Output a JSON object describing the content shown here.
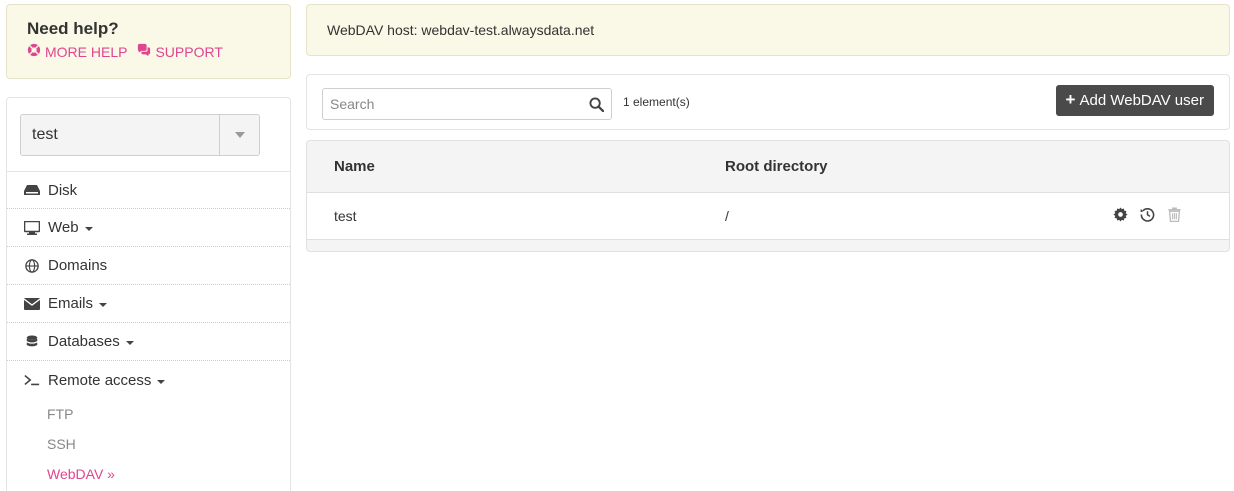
{
  "help": {
    "title": "Need help?",
    "more_help": "MORE HELP",
    "support": "SUPPORT"
  },
  "account": {
    "selected": "test"
  },
  "sidebar": {
    "items": [
      {
        "label": "Disk",
        "icon": "disk-icon",
        "has_caret": false
      },
      {
        "label": "Web",
        "icon": "monitor-icon",
        "has_caret": true
      },
      {
        "label": "Domains",
        "icon": "globe-icon",
        "has_caret": false
      },
      {
        "label": "Emails",
        "icon": "envelope-icon",
        "has_caret": true
      },
      {
        "label": "Databases",
        "icon": "database-icon",
        "has_caret": true
      },
      {
        "label": "Remote access",
        "icon": "terminal-icon",
        "has_caret": true
      }
    ],
    "subitems": [
      {
        "label": "FTP"
      },
      {
        "label": "SSH"
      },
      {
        "label": "WebDAV »"
      }
    ]
  },
  "banner": {
    "host_text": "WebDAV host: webdav-test.alwaysdata.net"
  },
  "toolbar": {
    "search_placeholder": "Search",
    "search_value": "",
    "count": "1 element(s)",
    "add_label": "Add WebDAV user"
  },
  "table": {
    "headers": {
      "name": "Name",
      "root": "Root directory"
    },
    "rows": [
      {
        "name": "test",
        "root": "/"
      }
    ]
  },
  "colors": {
    "accent": "#e0468f",
    "banner_bg": "#faf8e6",
    "button_bg": "#4a4a4a"
  }
}
